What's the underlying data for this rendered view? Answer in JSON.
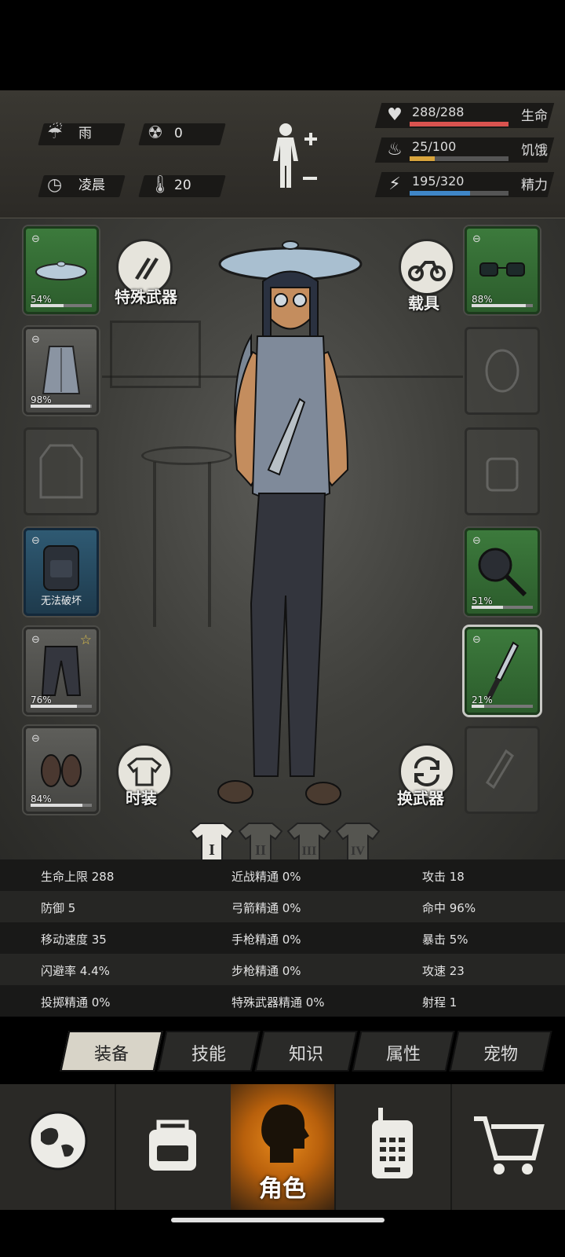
{
  "status": {
    "weather": "雨",
    "radiation": "0",
    "time_of_day": "凌晨",
    "temperature": "20",
    "vitals": [
      {
        "label": "生命",
        "value": "288/288",
        "fraction": 1.0,
        "color": "#d9534f",
        "icon": "heart-icon"
      },
      {
        "label": "饥饿",
        "value": "25/100",
        "fraction": 0.25,
        "color": "#d8a43c",
        "icon": "stomach-icon"
      },
      {
        "label": "精力",
        "value": "195/320",
        "fraction": 0.61,
        "color": "#3f86c7",
        "icon": "energy-icon"
      }
    ]
  },
  "left_slots": [
    {
      "name": "slot-head-pot-lid",
      "type": "green",
      "percent": "54%",
      "fraction": 0.54,
      "icon": "pot-lid-icon"
    },
    {
      "name": "slot-shirt",
      "type": "grey",
      "percent": "98%",
      "fraction": 0.98,
      "icon": "vest-shirt-icon"
    },
    {
      "name": "slot-coat",
      "type": "empty",
      "icon": "coat-icon"
    },
    {
      "name": "slot-backpack",
      "type": "blue",
      "note": "无法破坏",
      "icon": "backpack-icon"
    },
    {
      "name": "slot-pants",
      "type": "grey",
      "percent": "76%",
      "fraction": 0.76,
      "icon": "pants-icon",
      "starred": true
    },
    {
      "name": "slot-shoes",
      "type": "grey",
      "percent": "84%",
      "fraction": 0.84,
      "icon": "shoes-icon"
    }
  ],
  "right_slots": [
    {
      "name": "slot-glasses",
      "type": "green",
      "percent": "88%",
      "fraction": 0.88,
      "icon": "glasses-icon"
    },
    {
      "name": "slot-mask",
      "type": "empty",
      "icon": "gas-mask-icon"
    },
    {
      "name": "slot-pouch",
      "type": "empty",
      "icon": "pouch-icon"
    },
    {
      "name": "slot-frying-pan",
      "type": "green",
      "percent": "51%",
      "fraction": 0.51,
      "icon": "frying-pan-icon"
    },
    {
      "name": "slot-knife",
      "type": "green",
      "percent": "21%",
      "fraction": 0.21,
      "icon": "knife-icon",
      "selected": true
    },
    {
      "name": "slot-throwable",
      "type": "empty",
      "icon": "bottle-icon"
    }
  ],
  "buttons": {
    "special_weapon": "特殊武器",
    "vehicle": "载具",
    "fashion": "时装",
    "swap_weapon": "换武器"
  },
  "outfit_tabs": [
    "I",
    "II",
    "III",
    "IV"
  ],
  "stats": [
    [
      "生命上限 288",
      "近战精通 0%",
      "攻击 18"
    ],
    [
      "防御 5",
      "弓箭精通 0%",
      "命中 96%"
    ],
    [
      "移动速度 35",
      "手枪精通 0%",
      "暴击 5%"
    ],
    [
      "闪避率 4.4%",
      "步枪精通 0%",
      "攻速 23"
    ],
    [
      "投掷精通 0%",
      "特殊武器精通 0%",
      "射程 1"
    ]
  ],
  "tabs": [
    "装备",
    "技能",
    "知识",
    "属性",
    "宠物"
  ],
  "nav": {
    "active_label": "角色",
    "items": [
      "world-map-icon",
      "backpack-icon",
      "character-icon",
      "radio-icon",
      "shop-cart-icon"
    ]
  }
}
